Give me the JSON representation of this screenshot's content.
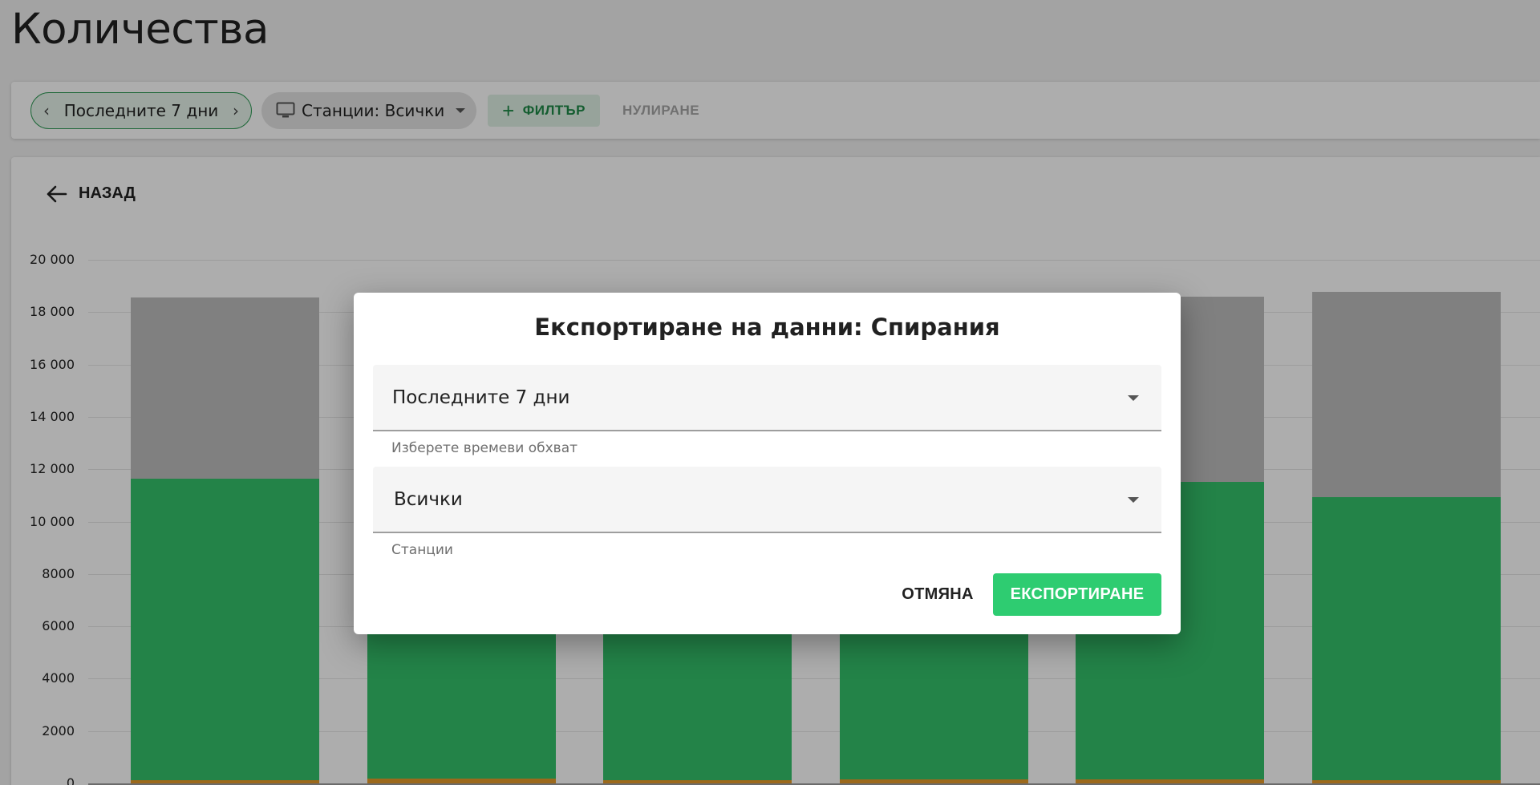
{
  "page": {
    "title": "Количества"
  },
  "filters": {
    "range_label": "Последните 7 дни",
    "stations_label": "Станции: Всички",
    "filter_button": "ФИЛТЪР",
    "reset_button": "НУЛИРАНЕ"
  },
  "main": {
    "back_label": "НАЗАД"
  },
  "colors": {
    "accent": "#2ecc71",
    "bar_green": "#34c26b",
    "bar_gray": "#bdbdbd",
    "bar_orange": "#e69b2a"
  },
  "chart_data": {
    "type": "bar",
    "stacked": true,
    "ylim": [
      0,
      20000
    ],
    "yticks": [
      "20 000",
      "18 000",
      "16 000",
      "14 000",
      "12 000",
      "10 000",
      "8000",
      "6000",
      "4000",
      "2000",
      "0"
    ],
    "ytick_values": [
      20000,
      18000,
      16000,
      14000,
      12000,
      10000,
      8000,
      6000,
      4000,
      2000,
      0
    ],
    "grid": true,
    "series": [
      {
        "color": "#e69b2a",
        "values": [
          120,
          170,
          110,
          150,
          150,
          130
        ]
      },
      {
        "color": "#34c26b",
        "values": [
          11530,
          11300,
          11400,
          11350,
          11380,
          10800
        ]
      },
      {
        "color": "#bdbdbd",
        "values": [
          6900,
          7100,
          7050,
          7050,
          7050,
          7850
        ]
      }
    ]
  },
  "dialog": {
    "title": "Експортиране на данни: Спирания",
    "range_value": "Последните 7 дни",
    "range_hint": "Изберете времеви обхват",
    "stations_value": "Всички",
    "stations_hint": "Станции",
    "cancel_label": "ОТМЯНА",
    "export_label": "ЕКСПОРТИРАНЕ"
  }
}
